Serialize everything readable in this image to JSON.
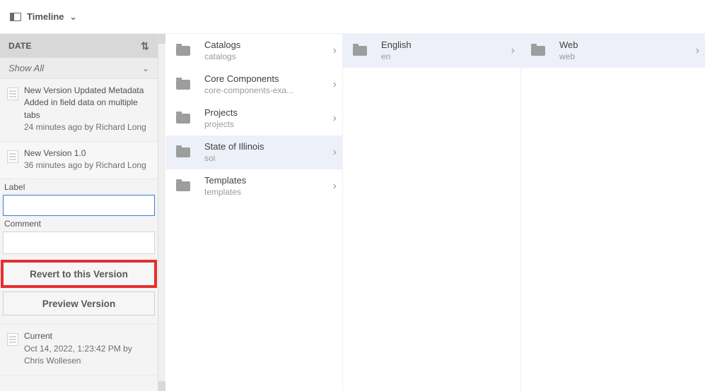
{
  "topbar": {
    "label": "Timeline"
  },
  "sidebar": {
    "header": "DATE",
    "filter": "Show All",
    "versions": [
      {
        "title": "New Version Updated Metadata",
        "desc": "Added in field data on multiple tabs",
        "meta": "24 minutes ago by Richard Long"
      },
      {
        "title": "New Version 1.0",
        "meta": "36 minutes ago by Richard Long"
      }
    ],
    "form": {
      "label_label": "Label",
      "label_value": "",
      "comment_label": "Comment",
      "comment_value": "",
      "revert_btn": "Revert to this Version",
      "preview_btn": "Preview Version"
    },
    "current": {
      "title": "Current",
      "meta": "Oct 14, 2022, 1:23:42 PM by Chris Wollesen"
    }
  },
  "columns": {
    "c1": [
      {
        "title": "Catalogs",
        "slug": "catalogs",
        "selected": false
      },
      {
        "title": "Core Components",
        "slug": "core-components-exa...",
        "selected": false
      },
      {
        "title": "Projects",
        "slug": "projects",
        "selected": false
      },
      {
        "title": "State of Illinois",
        "slug": "soi",
        "selected": true
      },
      {
        "title": "Templates",
        "slug": "templates",
        "selected": false
      }
    ],
    "c2": [
      {
        "title": "English",
        "slug": "en",
        "selected": true
      }
    ],
    "c3": [
      {
        "title": "Web",
        "slug": "web",
        "selected": true
      }
    ]
  }
}
